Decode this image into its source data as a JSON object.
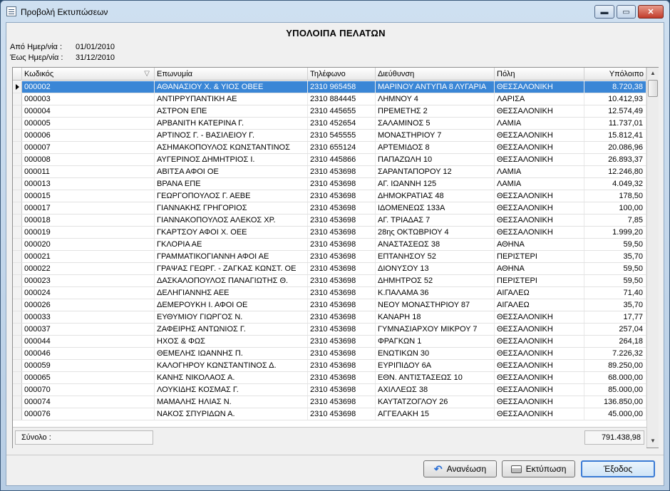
{
  "window": {
    "title": "Προβολή Εκτυπώσεων",
    "minimize_symbol": "▬",
    "maximize_symbol": "▭",
    "close_symbol": "✕",
    "app_icon": "report-viewer-icon"
  },
  "report": {
    "title": "ΥΠΟΛΟΙΠΑ ΠΕΛΑΤΩΝ",
    "from_label": "Από Ημερ/νία  :",
    "from_value": "01/01/2010",
    "to_label": "Έως Ημερ/νία  :",
    "to_value": "31/12/2010"
  },
  "grid": {
    "columns": [
      "Κωδικός",
      "Επωνυμία",
      "Τηλέφωνο",
      "Διεύθυνση",
      "Πόλη",
      "Υπόλοιπο"
    ],
    "sort_icon": "▽",
    "selected_row": 0,
    "rows": [
      [
        "000002",
        "ΑΘΑΝΑΣΙΟΥ Χ. & ΥΙΟΣ ΟΒΕΕ",
        "2310 965458",
        "ΜΑΡΙΝΟΥ ΑΝΤΥΠΑ 8 ΛΥΓΑΡΙΑ",
        "ΘΕΣΣΑΛΟΝΙΚΗ",
        "8.720,38"
      ],
      [
        "000003",
        "ΑΝΤΙΡΡΥΠΑΝΤΙΚΗ ΑΕ",
        "2310 884445",
        "ΛΗΜΝΟΥ 4",
        "ΛΑΡΙΣΑ",
        "10.412,93"
      ],
      [
        "000004",
        "ΑΣΤΡΟΝ ΕΠΕ",
        "2310 445655",
        "ΠΡΕΜΕΤΗΣ 2",
        "ΘΕΣΣΑΛΟΝΙΚΗ",
        "12.574,49"
      ],
      [
        "000005",
        "ΑΡΒΑΝΙΤΗ ΚΑΤΕΡΙΝΑ Γ.",
        "2310 452654",
        "ΣΑΛΑΜΙΝΟΣ 5",
        "ΛΑΜΙΑ",
        "11.737,01"
      ],
      [
        "000006",
        "ΑΡΤΙΝΟΣ Γ. - ΒΑΣΙΛΕΙΟΥ Γ.",
        "2310 545555",
        "ΜΟΝΑΣΤΗΡΙΟΥ 7",
        "ΘΕΣΣΑΛΟΝΙΚΗ",
        "15.812,41"
      ],
      [
        "000007",
        "ΑΣΗΜΑΚΟΠΟΥΛΟΣ ΚΩΝΣΤΑΝΤΙΝΟΣ",
        "2310 655124",
        "ΑΡΤΕΜΙΔΟΣ 8",
        "ΘΕΣΣΑΛΟΝΙΚΗ",
        "20.086,96"
      ],
      [
        "000008",
        "ΑΥΓΕΡΙΝΟΣ ΔΗΜΗΤΡΙΟΣ Ι.",
        "2310 445866",
        "ΠΑΠΑΖΩΛΗ 10",
        "ΘΕΣΣΑΛΟΝΙΚΗ",
        "26.893,37"
      ],
      [
        "000011",
        "ΑΒΙΤΣΑ ΑΦΟΙ ΟΕ",
        "2310 453698",
        "ΣΑΡΑΝΤΑΠΟΡΟΥ 12",
        "ΛΑΜΙΑ",
        "12.246,80"
      ],
      [
        "000013",
        "ΒΡΑΝΑ ΕΠΕ",
        "2310 453698",
        "ΑΓ. ΙΩΑΝΝΗ 125",
        "ΛΑΜΙΑ",
        "4.049,32"
      ],
      [
        "000015",
        "ΓΕΩΡΓΟΠΟΥΛΟΣ Γ. ΑΕΒΕ",
        "2310 453698",
        "ΔΗΜΟΚΡΑΤΙΑΣ 48",
        "ΘΕΣΣΑΛΟΝΙΚΗ",
        "178,50"
      ],
      [
        "000017",
        "ΓΙΑΝΝΑΚΗΣ ΓΡΗΓΟΡΙΟΣ",
        "2310 453698",
        "ΙΔΟΜΕΝΕΩΣ 133Α",
        "ΘΕΣΣΑΛΟΝΙΚΗ",
        "100,00"
      ],
      [
        "000018",
        "ΓΙΑΝΝΑΚΟΠΟΥΛΟΣ ΑΛΕΚΟΣ ΧΡ.",
        "2310 453698",
        "ΑΓ. ΤΡΙΑΔΑΣ 7",
        "ΘΕΣΣΑΛΟΝΙΚΗ",
        "7,85"
      ],
      [
        "000019",
        "ΓΚΑΡΤΣΟΥ ΑΦΟΙ Χ. ΟΕΕ",
        "2310 453698",
        "28ης ΟΚΤΩΒΡΙΟΥ 4",
        "ΘΕΣΣΑΛΟΝΙΚΗ",
        "1.999,20"
      ],
      [
        "000020",
        "ΓΚΛΟΡΙΑ ΑΕ",
        "2310 453698",
        "ΑΝΑΣΤΑΣΕΩΣ 38",
        "ΑΘΗΝΑ",
        "59,50"
      ],
      [
        "000021",
        "ΓΡΑΜΜΑΤΙΚΟΓΙΑΝΝΗ ΑΦΟΙ ΑΕ",
        "2310 453698",
        "ΕΠΤΑΝΗΣΟΥ 52",
        "ΠΕΡΙΣΤΕΡΙ",
        "35,70"
      ],
      [
        "000022",
        "ΓΡΑΨΑΣ ΓΕΩΡΓ. - ΖΑΓΚΑΣ ΚΩΝΣΤ. ΟΕ",
        "2310 453698",
        "ΔΙΟΝΥΣΟΥ 13",
        "ΑΘΗΝΑ",
        "59,50"
      ],
      [
        "000023",
        "ΔΑΣΚΑΛΟΠΟΥΛΟΣ ΠΑΝΑΓΙΩΤΗΣ Θ.",
        "2310 453698",
        "ΔΗΜΗΤΡΟΣ 52",
        "ΠΕΡΙΣΤΕΡΙ",
        "59,50"
      ],
      [
        "000024",
        "ΔΕΛΗΓΙΑΝΝΗΣ ΑΕΕ",
        "2310 453698",
        "Κ.ΠΑΛΑΜΑ 36",
        "ΑΙΓΑΛΕΩ",
        "71,40"
      ],
      [
        "000026",
        "ΔΕΜΕΡΟΥΚΗ Ι. ΑΦΟΙ ΟΕ",
        "2310 453698",
        "ΝΕΟΥ ΜΟΝΑΣΤΗΡΙΟΥ 87",
        "ΑΙΓΑΛΕΩ",
        "35,70"
      ],
      [
        "000033",
        "ΕΥΘΥΜΙΟΥ ΓΙΩΡΓΟΣ Ν.",
        "2310 453698",
        "ΚΑΝΑΡΗ 18",
        "ΘΕΣΣΑΛΟΝΙΚΗ",
        "17,77"
      ],
      [
        "000037",
        "ΖΑΦΕΙΡΗΣ ΑΝΤΩΝΙΟΣ Γ.",
        "2310 453698",
        "ΓΥΜΝΑΣΙΑΡΧΟΥ ΜΙΚΡΟΥ 7",
        "ΘΕΣΣΑΛΟΝΙΚΗ",
        "257,04"
      ],
      [
        "000044",
        "ΗΧΟΣ & ΦΩΣ",
        "2310 453698",
        "ΦΡΑΓΚΩΝ 1",
        "ΘΕΣΣΑΛΟΝΙΚΗ",
        "264,18"
      ],
      [
        "000046",
        "ΘΕΜΕΛΗΣ ΙΩΑΝΝΗΣ Π.",
        "2310 453698",
        "ΕΝΩΤΙΚΩΝ 30",
        "ΘΕΣΣΑΛΟΝΙΚΗ",
        "7.226,32"
      ],
      [
        "000059",
        "ΚΑΛΟΓΗΡΟΥ ΚΩΝΣΤΑΝΤΙΝΟΣ Δ.",
        "2310 453698",
        "ΕΥΡΙΠΙΔΟΥ 6Α",
        "ΘΕΣΣΑΛΟΝΙΚΗ",
        "89.250,00"
      ],
      [
        "000065",
        "ΚΑΝΗΣ ΝΙΚΟΛΑΟΣ Α.",
        "2310 453698",
        "ΕΘΝ. ΑΝΤΙΣΤΑΣΕΩΣ 10",
        "ΘΕΣΣΑΛΟΝΙΚΗ",
        "68.000,00"
      ],
      [
        "000070",
        "ΛΟΥΚΙΔΗΣ ΚΟΣΜΑΣ Γ.",
        "2310 453698",
        "ΑΧΙΛΛΕΩΣ 38",
        "ΘΕΣΣΑΛΟΝΙΚΗ",
        "85.000,00"
      ],
      [
        "000074",
        "ΜΑΜΑΛΗΣ ΗΛΙΑΣ Ν.",
        "2310 453698",
        "ΚΑΥΤΑΤΖΟΓΛΟΥ 26",
        "ΘΕΣΣΑΛΟΝΙΚΗ",
        "136.850,00"
      ],
      [
        "000076",
        "ΝΑΚΟΣ ΣΠΥΡΙΔΩΝ Α.",
        "2310 453698",
        "ΑΓΓΕΛΑΚΗ 15",
        "ΘΕΣΣΑΛΟΝΙΚΗ",
        "45.000,00"
      ]
    ],
    "scroll_up_symbol": "▲",
    "scroll_down_symbol": "▼"
  },
  "footer": {
    "total_label": "Σύνολο :",
    "total_value": "791.438,98"
  },
  "buttons": {
    "refresh_label": "Ανανέωση",
    "print_label": "Εκτύπωση",
    "exit_label": "Έξοδος",
    "refresh_icon": "↶"
  },
  "colors": {
    "selection": "#3a86d6",
    "default_button_border": "#3a7bd5"
  }
}
